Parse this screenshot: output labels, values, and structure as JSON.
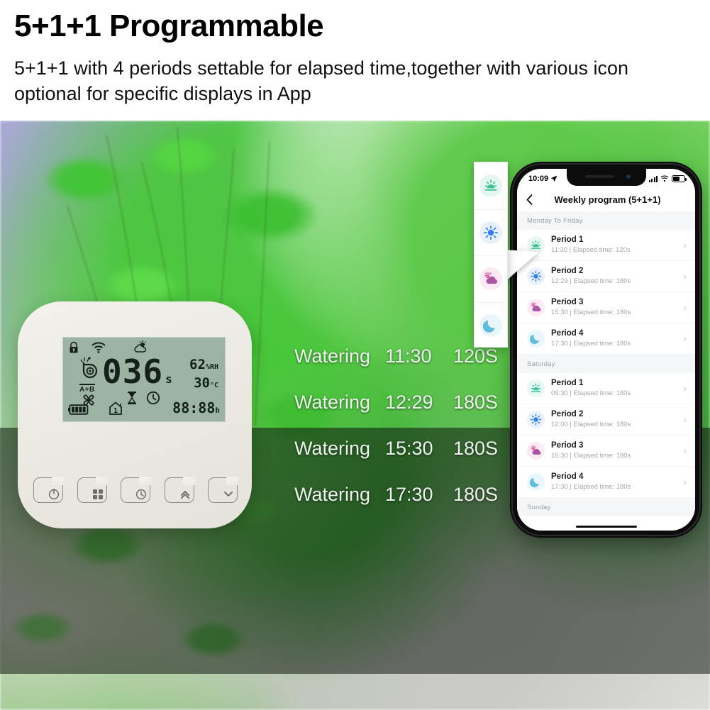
{
  "header": {
    "title": "5+1+1 Programmable",
    "subtitle": "5+1+1 with 4 periods settable for elapsed time,together with various icon optional for specific displays in App"
  },
  "device": {
    "lcd": {
      "value": "036",
      "value_unit": "s",
      "humidity": "62",
      "humidity_unit": "%RH",
      "temperature": "30",
      "temperature_unit": "°C",
      "zone_label": "A+B",
      "house_number": "1",
      "clock": "88:88",
      "clock_unit": "h",
      "icons": [
        "lock-icon",
        "wifi-icon",
        "partly-cloudy-icon",
        "sprinkler-icon",
        "fan-icon",
        "hourglass-icon",
        "clock-icon",
        "battery-icon",
        "house-icon"
      ]
    },
    "buttons": [
      {
        "name": "power-button",
        "icon": "power-icon"
      },
      {
        "name": "menu-button",
        "icon": "grid-icon"
      },
      {
        "name": "timer-button",
        "icon": "clock-icon"
      },
      {
        "name": "up-button",
        "icon": "chevron-up-icon"
      },
      {
        "name": "down-button",
        "icon": "chevron-down-icon"
      }
    ]
  },
  "watering_overlay": {
    "rows": [
      {
        "label": "Watering",
        "time": "11:30",
        "duration": "120S"
      },
      {
        "label": "Watering",
        "time": "12:29",
        "duration": "180S"
      },
      {
        "label": "Watering",
        "time": "15:30",
        "duration": "180S"
      },
      {
        "label": "Watering",
        "time": "17:30",
        "duration": "180S"
      }
    ]
  },
  "icon_callout": {
    "items": [
      {
        "name": "sunrise-icon",
        "color": "#3fbf9a",
        "bubble": "#e6f7f1"
      },
      {
        "name": "sun-icon",
        "color": "#2f7ef0",
        "bubble": "#e8f0fd"
      },
      {
        "name": "partly-cloudy-icon",
        "color": "#b4569b",
        "bubble": "#fbeaf4"
      },
      {
        "name": "moon-icon",
        "color": "#5fbcdd",
        "bubble": "#e8f6fb"
      }
    ]
  },
  "phone": {
    "status_bar": {
      "time": "10:09",
      "location_icon": "location-arrow-icon",
      "signal_icon": "cellular-bars-icon",
      "wifi_icon": "wifi-icon",
      "battery_icon": "battery-icon"
    },
    "nav": {
      "back_icon": "chevron-left-icon",
      "title": "Weekly program (5+1+1)"
    },
    "groups": [
      {
        "label": "Monday To Friday",
        "periods": [
          {
            "title": "Period 1",
            "meta": "11:30  |  Elapsed time: 120s",
            "icon": "sunrise-icon",
            "color": "#3fbf9a",
            "bubble": "#e7f8f2"
          },
          {
            "title": "Period 2",
            "meta": "12:29  |  Elapsed time: 180s",
            "icon": "sun-icon",
            "color": "#2f7ef0",
            "bubble": "#e9f1fe"
          },
          {
            "title": "Period 3",
            "meta": "15:30  |  Elapsed time: 180s",
            "icon": "partly-cloudy-icon",
            "color": "#b4569b",
            "bubble": "#fceaf5"
          },
          {
            "title": "Period 4",
            "meta": "17:30  |  Elapsed time: 180s",
            "icon": "moon-icon",
            "color": "#5fbcdd",
            "bubble": "#e9f7fc"
          }
        ]
      },
      {
        "label": "Saturday",
        "periods": [
          {
            "title": "Period 1",
            "meta": "09:30  |  Elapsed time: 180s",
            "icon": "sunrise-icon",
            "color": "#3fbf9a",
            "bubble": "#e7f8f2"
          },
          {
            "title": "Period 2",
            "meta": "12:00  |  Elapsed time: 180s",
            "icon": "sun-icon",
            "color": "#2f7ef0",
            "bubble": "#e9f1fe"
          },
          {
            "title": "Period 3",
            "meta": "15:30  |  Elapsed time: 180s",
            "icon": "partly-cloudy-icon",
            "color": "#b4569b",
            "bubble": "#fceaf5"
          },
          {
            "title": "Period 4",
            "meta": "17:30  |  Elapsed time: 180s",
            "icon": "moon-icon",
            "color": "#5fbcdd",
            "bubble": "#e9f7fc"
          }
        ]
      },
      {
        "label": "Sunday",
        "periods": []
      }
    ],
    "chevron": "›"
  }
}
